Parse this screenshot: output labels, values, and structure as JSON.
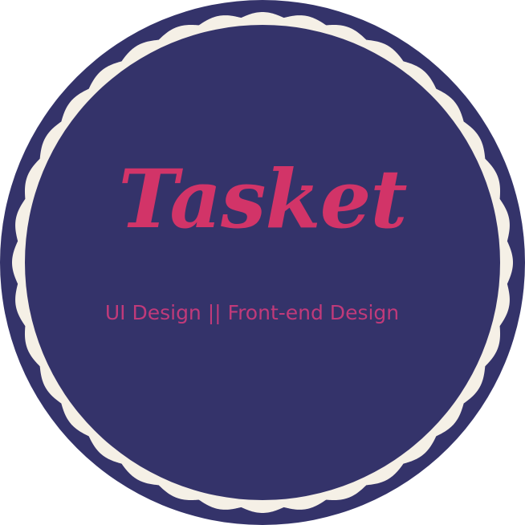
{
  "badge": {
    "title": "Tasket",
    "subtitle": "UI Design || Front-end Design"
  },
  "colors": {
    "background": "#ffffff",
    "outer_ring": "#34336a",
    "scallop_border": "#f5f0e6",
    "inner_circle": "#34336a",
    "title": "#d23468",
    "subtitle": "#c03a7a"
  }
}
